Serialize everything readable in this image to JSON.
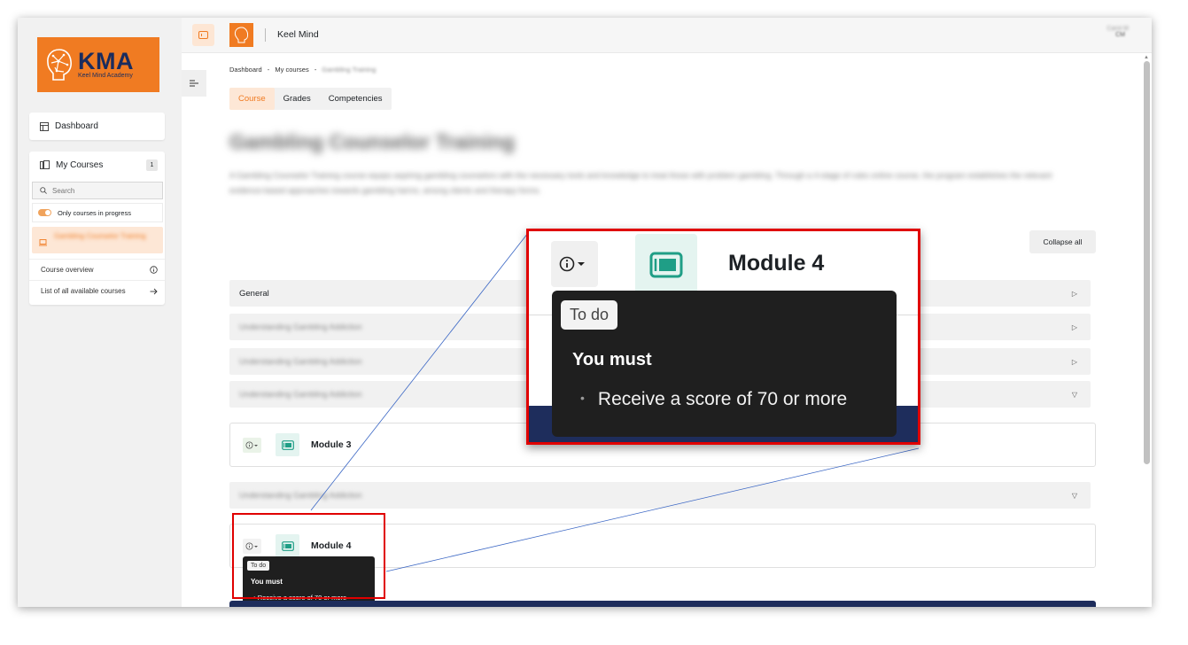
{
  "brand": {
    "logo_abbrev": "KMA",
    "logo_subtitle": "Keel Mind Academy",
    "accent_color": "#f07b22",
    "navy_color": "#1e2d5c"
  },
  "topbar": {
    "site_title": "Keel Mind",
    "user_name": "Carol M",
    "user_initials": "CM"
  },
  "sidebar": {
    "dashboard_label": "Dashboard",
    "my_courses_label": "My Courses",
    "my_courses_count": "1",
    "search_placeholder": "Search",
    "filter_label": "Only courses in progress",
    "current_course": "Gambling Counselor Training",
    "course_overview_label": "Course overview",
    "all_courses_label": "List of all available courses"
  },
  "breadcrumb": {
    "item1": "Dashboard",
    "sep": "-",
    "item2": "My courses",
    "item3": "Gambling Training"
  },
  "tabs": [
    {
      "label": "Course",
      "active": true
    },
    {
      "label": "Grades",
      "active": false
    },
    {
      "label": "Competencies",
      "active": false
    }
  ],
  "course": {
    "title": "Gambling Counselor Training",
    "description": "A Gambling Counselor Training course equips aspiring gambling counselors with the necessary tools and knowledge to treat those with problem gambling. Through a 4-stage of rules online course, the program establishes the relevant evidence-based approaches towards gambling harms, among clients and therapy forms.",
    "collapse_all": "Collapse all"
  },
  "sections": [
    {
      "label": "General",
      "blurred": false,
      "caret": "▷"
    },
    {
      "label": "Understanding Gambling Addiction",
      "blurred": true,
      "caret": "▷"
    },
    {
      "label": "Understanding Gambling Addiction",
      "blurred": true,
      "caret": "▷"
    },
    {
      "label": "Understanding Gambling Addiction",
      "blurred": true,
      "caret": "▽"
    },
    {
      "label": "Understanding Gambling Addiction",
      "blurred": true,
      "caret": "▽"
    }
  ],
  "modules": {
    "module3": "Module 3",
    "module4": "Module 4"
  },
  "tooltip": {
    "badge": "To do",
    "heading": "You must",
    "requirement": "Receive a score of 70 or more"
  }
}
